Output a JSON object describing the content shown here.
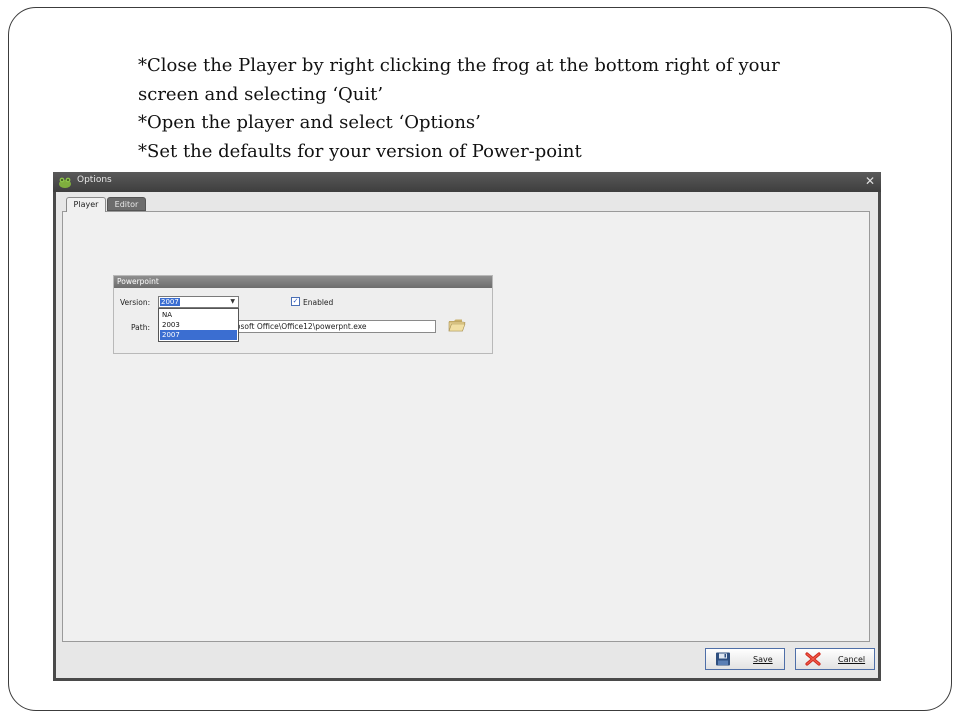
{
  "instructions": {
    "line1": "*Close the Player by right clicking the frog at the bottom right of your",
    "line2": "screen and selecting ‘Quit’",
    "line3": "*Open the player and select ‘Options’",
    "line4": "*Set the defaults for your version of Power-point"
  },
  "dialog": {
    "title": "Options",
    "close_icon": "close-icon",
    "app_icon": "frog-icon",
    "tabs": [
      {
        "label": "Player",
        "active": true
      },
      {
        "label": "Editor",
        "active": false
      }
    ],
    "group": {
      "title": "Powerpoint",
      "version_label": "Version:",
      "version_value": "2007",
      "version_options": [
        "NA",
        "2003",
        "2007"
      ],
      "enabled_label": "Enabled",
      "enabled_checked": true,
      "path_label": "Path:",
      "path_value": "rosoft Office\\Office12\\powerpnt.exe",
      "browse_icon": "folder-open-icon"
    },
    "buttons": {
      "save_label": "Save",
      "cancel_label": "Cancel",
      "save_icon": "floppy-disk-icon",
      "cancel_icon": "red-x-icon"
    }
  },
  "colors": {
    "selection": "#3b6ed1",
    "title_bar": "#4a4a4a",
    "group_header": "#7d7d7d"
  }
}
